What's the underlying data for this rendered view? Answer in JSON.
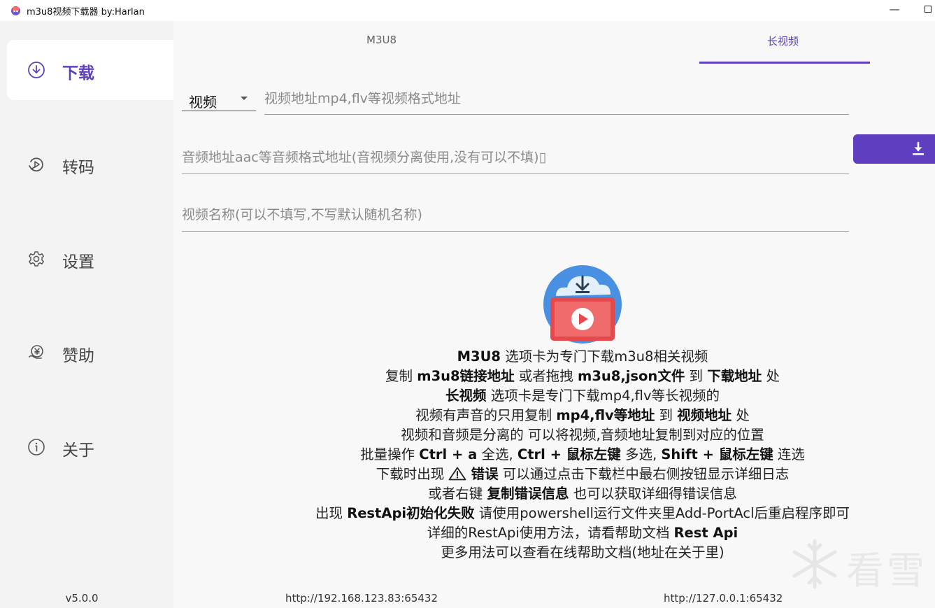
{
  "window": {
    "title": "m3u8视频下载器 by:Harlan",
    "minimize_glyph": "—"
  },
  "sidebar": {
    "items": [
      {
        "label": "下载",
        "icon": "download-circle-icon",
        "active": true
      },
      {
        "label": "转码",
        "icon": "transcode-icon",
        "active": false
      },
      {
        "label": "设置",
        "icon": "gear-icon",
        "active": false
      },
      {
        "label": "赞助",
        "icon": "sponsor-icon",
        "active": false
      },
      {
        "label": "关于",
        "icon": "info-icon",
        "active": false
      }
    ],
    "version": "v5.0.0"
  },
  "tabs": [
    {
      "label": "M3U8",
      "active": false
    },
    {
      "label": "长视频",
      "active": true
    }
  ],
  "form": {
    "type_select": {
      "value": "视频"
    },
    "video_url": {
      "value": "",
      "placeholder": "视频地址mp4,flv等视频格式地址"
    },
    "audio_url": {
      "value": "",
      "placeholder": "音频地址aac等音频格式地址(音视频分离使用,没有可以不填)▯"
    },
    "video_name": {
      "value": "",
      "placeholder": "视频名称(可以不填写,不写默认随机名称)"
    }
  },
  "download_button": {
    "icon": "download-arrow-icon"
  },
  "help": {
    "l1": {
      "a": "M3U8",
      "b": " 选项卡为专门下载m3u8相关视频"
    },
    "l2": {
      "a": "复制 ",
      "b": "m3u8链接地址",
      "c": " 或者拖拽 ",
      "d": "m3u8,json文件",
      "e": " 到 ",
      "f": "下载地址",
      "g": " 处"
    },
    "l3": {
      "a": "长视频",
      "b": " 选项卡是专门下载mp4,flv等长视频的"
    },
    "l4": {
      "a": "视频有声音的只用复制 ",
      "b": "mp4,flv等地址",
      "c": " 到 ",
      "d": "视频地址",
      "e": " 处"
    },
    "l5": {
      "a": "视频和音频是分离的 可以将视频,音频地址复制到对应的位置"
    },
    "l6": {
      "a": "批量操作 ",
      "b": "Ctrl + a",
      "c": " 全选, ",
      "d": "Ctrl + 鼠标左键",
      "e": " 多选, ",
      "f": "Shift + 鼠标左键",
      "g": " 连选"
    },
    "l7": {
      "a": "下载时出现 ",
      "b": "错误",
      "c": " 可以通过点击下载栏中最右侧按钮显示详细日志"
    },
    "l8": {
      "a": "或者右键 ",
      "b": "复制错误信息",
      "c": " 也可以获取详细得错误信息"
    },
    "l9": {
      "a": "出现 ",
      "b": "RestApi初始化失败",
      "c": " 请使用powershell运行文件夹里Add-PortAcl后重启程序即可"
    },
    "l10": {
      "a": "详细的RestApi使用方法，请看帮助文档 ",
      "b": "Rest Api"
    },
    "l11": {
      "a": "更多用法可以查看在线帮助文档(地址在关于里)"
    }
  },
  "footer": {
    "ip_lan": "http://192.168.123.83:65432",
    "ip_local": "http://127.0.0.1:65432"
  },
  "watermark": {
    "text": "看雪"
  },
  "colors": {
    "accent": "#5f3fc0",
    "sidebar_bg": "#f3f3f3",
    "main_bg": "#f8f8f8"
  }
}
